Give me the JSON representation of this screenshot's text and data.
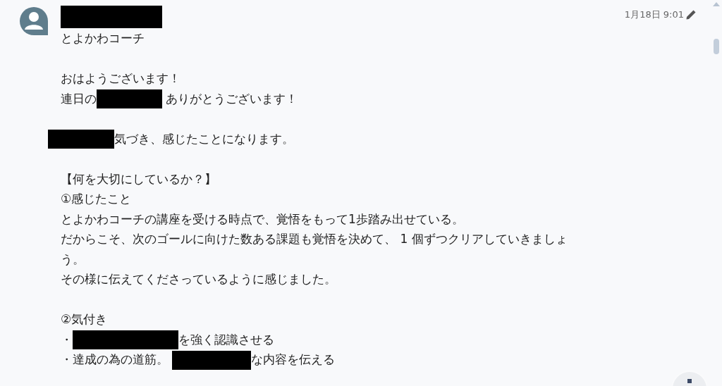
{
  "message": {
    "author_role": "とよかわコーチ",
    "timestamp": "1月18日 9:01",
    "paragraphs": [
      [
        {
          "segments": [
            {
              "kind": "text",
              "text": "おはようございます！"
            }
          ]
        },
        {
          "segments": [
            {
              "kind": "text",
              "text": "連日の"
            },
            {
              "kind": "redacted"
            },
            {
              "kind": "text",
              "text": " ありがとうございます！"
            }
          ]
        }
      ],
      [
        {
          "segments": [
            {
              "kind": "redacted"
            },
            {
              "kind": "text",
              "text": "気づき、感じたことになります。"
            }
          ]
        }
      ],
      [
        {
          "segments": [
            {
              "kind": "text",
              "text": "【何を大切にしているか？】"
            }
          ]
        },
        {
          "segments": [
            {
              "kind": "text",
              "text": "①感じたこと"
            }
          ]
        },
        {
          "segments": [
            {
              "kind": "text",
              "text": "とよかわコーチの講座を受ける時点で、覚悟をもって1歩踏み出せている。"
            }
          ]
        },
        {
          "segments": [
            {
              "kind": "text",
              "text": "だからこそ、次のゴールに向けた数ある課題も覚悟を決めて、 1 個ずつクリアしていきましょ"
            }
          ]
        },
        {
          "segments": [
            {
              "kind": "text",
              "text": "う。"
            }
          ]
        },
        {
          "segments": [
            {
              "kind": "text",
              "text": "その様に伝えてくださっているように感じました。"
            }
          ]
        }
      ],
      [
        {
          "segments": [
            {
              "kind": "text",
              "text": "②気付き"
            }
          ]
        },
        {
          "segments": [
            {
              "kind": "text",
              "text": "・"
            },
            {
              "kind": "redacted"
            },
            {
              "kind": "text",
              "text": "を強く認識させる"
            }
          ]
        },
        {
          "segments": [
            {
              "kind": "text",
              "text": "・達成の為の道筋。 "
            },
            {
              "kind": "redacted"
            },
            {
              "kind": "text",
              "text": "な内容を伝える"
            }
          ]
        }
      ]
    ]
  }
}
